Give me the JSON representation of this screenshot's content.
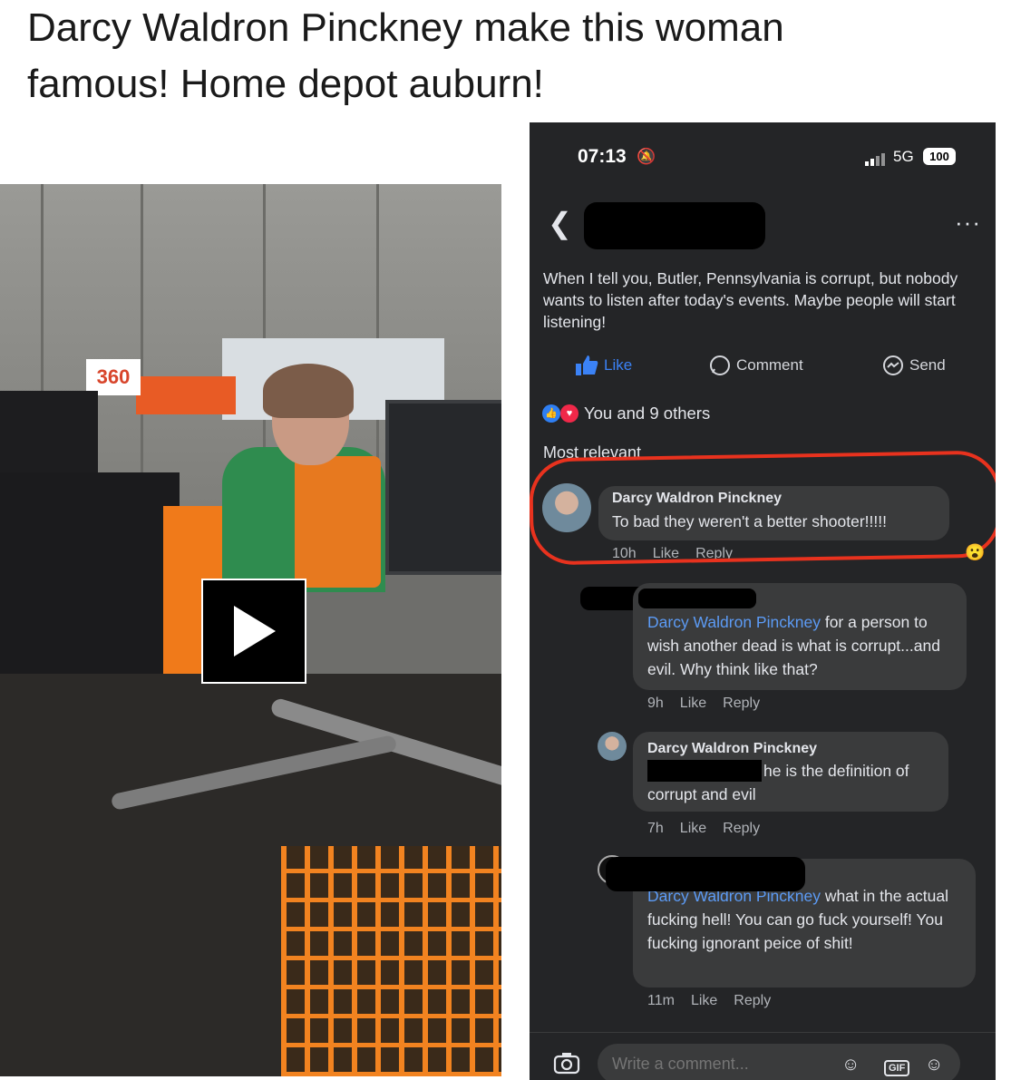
{
  "post": {
    "title": "Darcy Waldron Pinckney make this woman famous! Home depot auburn!"
  },
  "photo": {
    "sign_text": "360",
    "play_icon": "play-icon"
  },
  "phone": {
    "status": {
      "time": "07:13",
      "network": "5G",
      "battery": "100"
    },
    "post_text": "When I tell you, Butler, Pennsylvania is corrupt, but nobody wants to listen after today's events. Maybe people will  start listening!",
    "actions": {
      "like": "Like",
      "comment": "Comment",
      "send": "Send"
    },
    "reactions_text": "You and 9 others",
    "sort_label": "Most relevant",
    "comments": [
      {
        "author": "Darcy Waldron Pinckney",
        "text": "To bad they weren't a better shooter!!!!!",
        "time": "10h",
        "like": "Like",
        "reply": "Reply"
      },
      {
        "mention": "Darcy Waldron Pinckney",
        "text": "for a person to wish another dead is what is corrupt...and evil. Why think like that?",
        "time": "9h",
        "like": "Like",
        "reply": "Reply"
      },
      {
        "author": "Darcy Waldron Pinckney",
        "text": "he is the definition of corrupt and evil",
        "time": "7h",
        "like": "Like",
        "reply": "Reply"
      },
      {
        "mention": "Darcy Waldron Pinckney",
        "text": "what in the actual fucking hell! You can go fuck yourself! You fucking ignorant peice of shit!",
        "time": "11m",
        "like": "Like",
        "reply": "Reply"
      }
    ],
    "comment_bar": {
      "placeholder": "Write a comment...",
      "gif": "GIF"
    }
  }
}
